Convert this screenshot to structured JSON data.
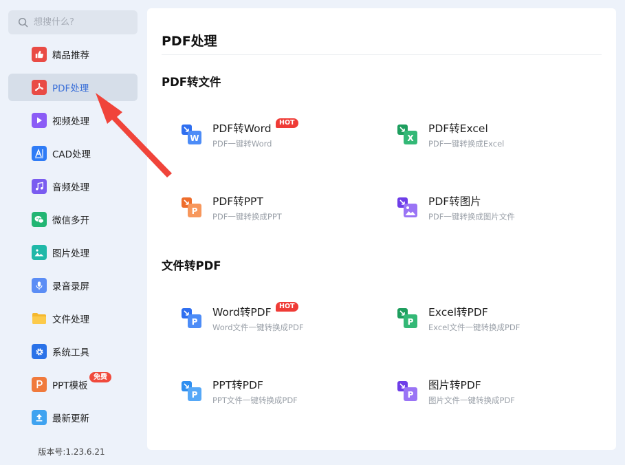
{
  "search": {
    "placeholder": "想搜什么?"
  },
  "sidebar": {
    "items": [
      {
        "label": "精品推荐",
        "icon": "thumbs-up-icon",
        "color": "#e94b45"
      },
      {
        "label": "PDF处理",
        "icon": "pdf-icon",
        "color": "#e94b45"
      },
      {
        "label": "视频处理",
        "icon": "play-icon",
        "color": "#8b5cf6"
      },
      {
        "label": "CAD处理",
        "icon": "cad-icon",
        "color": "#2f7cf6"
      },
      {
        "label": "音频处理",
        "icon": "music-note-icon",
        "color": "#7a5cf0"
      },
      {
        "label": "微信多开",
        "icon": "wechat-icon",
        "color": "#22b573"
      },
      {
        "label": "图片处理",
        "icon": "image-icon",
        "color": "#1fb8a8"
      },
      {
        "label": "录音录屏",
        "icon": "microphone-icon",
        "color": "#5b8df5"
      },
      {
        "label": "文件处理",
        "icon": "folder-icon",
        "color": "#f5b82e"
      },
      {
        "label": "系统工具",
        "icon": "gear-icon",
        "color": "#2a72e8"
      },
      {
        "label": "PPT模板",
        "icon": "ppt-icon",
        "color": "#f07a3c",
        "badge": "免费"
      },
      {
        "label": "最新更新",
        "icon": "upload-icon",
        "color": "#3fa3f0"
      }
    ],
    "version": "版本号:1.23.6.21"
  },
  "main": {
    "title": "PDF处理",
    "sections": [
      {
        "title": "PDF转文件",
        "cards": [
          {
            "title": "PDF转Word",
            "subtitle": "PDF一键转Word",
            "badge": "HOT",
            "letter": "W",
            "color": "#2f6ff0"
          },
          {
            "title": "PDF转Excel",
            "subtitle": "PDF一键转换成Excel",
            "letter": "X",
            "color": "#21a366"
          },
          {
            "title": "PDF转PPT",
            "subtitle": "PDF一键转换成PPT",
            "letter": "P",
            "color": "#f07a3c"
          },
          {
            "title": "PDF转图片",
            "subtitle": "PDF一键转换成图片文件",
            "letter": "img",
            "color": "#7c4df0"
          }
        ]
      },
      {
        "title": "文件转PDF",
        "cards": [
          {
            "title": "Word转PDF",
            "subtitle": "Word文件一键转换成PDF",
            "badge": "HOT",
            "letter": "P",
            "color": "#2f6ff0"
          },
          {
            "title": "Excel转PDF",
            "subtitle": "Excel文件一键转换成PDF",
            "letter": "P",
            "color": "#21a366"
          },
          {
            "title": "PPT转PDF",
            "subtitle": "PPT文件一键转换成PDF",
            "letter": "P",
            "color": "#2f8ff0"
          },
          {
            "title": "图片转PDF",
            "subtitle": "图片文件一键转换成PDF",
            "letter": "P",
            "color": "#7c4df0"
          }
        ]
      }
    ]
  },
  "colors": {
    "accent": "#3a6fd8",
    "hot": "#ef3b36",
    "arrow": "#f0443a"
  }
}
